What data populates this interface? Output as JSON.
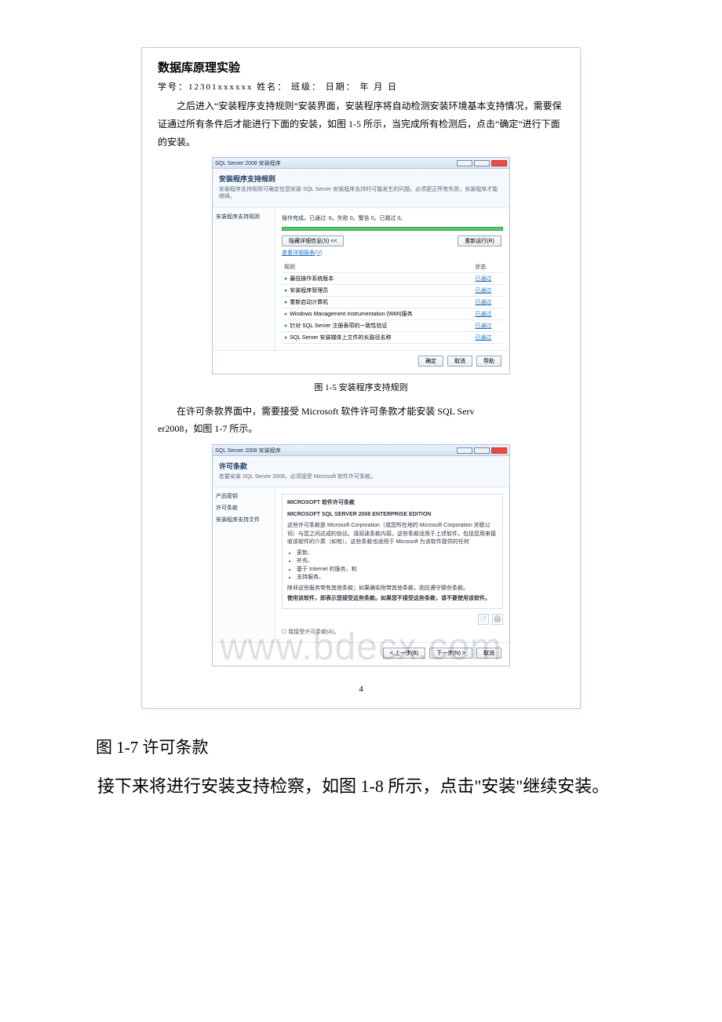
{
  "document": {
    "title": "数据库原理实验",
    "meta": "学号：12301xxxxxx    姓名：          班级：          日期：  年  月  日",
    "para1": "之后进入“安装程序支持规则”安装界面，安装程序将自动检测安装环境基本支持情况，需要保证通过所有条件后才能进行下面的安装，如图 1-5 所示，当完成所有检测后，点击“确定”进行下面的安装。",
    "para2_a": "在许可条款界面中，需要接受 Microsoft 软件许可条款才能安装 SQL Serv",
    "para2_b": "er2008，如图 1-7 所示。",
    "caption1": "图 1-5 安装程序支持规则",
    "page_num": "4"
  },
  "shot1": {
    "titlebar": "SQL Server 2008 安装程序",
    "heading": "安装程序支持规则",
    "desc": "安装程序支持规则可确定在您安装 SQL Server 安装程序支持时可能发生的问题。必须更正所有失败，安装程序才能继续。",
    "nav": [
      "安装程序支持规则"
    ],
    "status": "操作完成。已通过: 6。失败 0。警告 0。已跳过 0。",
    "btn_hide": "隐藏详细信息(S) <<",
    "btn_report": "查看详细报表(V)",
    "btn_rerun": "重新运行(R)",
    "table_head": [
      "规则",
      "状态"
    ],
    "rules": [
      {
        "name": "最低操作系统版本",
        "status": "已通过"
      },
      {
        "name": "安装程序管理员",
        "status": "已通过"
      },
      {
        "name": "重新启动计算机",
        "status": "已通过"
      },
      {
        "name": "Windows Management Instrumentation (WMI)服务",
        "status": "已通过"
      },
      {
        "name": "针对 SQL Server 注册表项的一致性验证",
        "status": "已通过"
      },
      {
        "name": "SQL Server 安装媒体上文件的长路径名称",
        "status": "已通过"
      }
    ],
    "footer": [
      "确定",
      "取消",
      "帮助"
    ]
  },
  "shot2": {
    "titlebar": "SQL Server 2008 安装程序",
    "heading": "许可条款",
    "desc": "若要安装 SQL Server 2008，必须接受 Microsoft 软件许可条款。",
    "nav": [
      "产品密钥",
      "许可条款",
      "安装程序支持文件"
    ],
    "lic_title": "MICROSOFT 软件许可条款",
    "lic_sub": "MICROSOFT SQL SERVER 2008 ENTERPRISE EDITION",
    "lic_body": "这些许可条款是 Microsoft Corporation（或您所在地的 Microsoft Corporation 关联公司）与您之间达成的协议。请阅读条款内容。这些条款适用于上述软件，包括您用来接收该软件的介质（如有）。这些条款也适用于 Microsoft 为该软件提供的任何",
    "bullets": [
      "更新、",
      "补充、",
      "基于 Internet 的服务，和",
      "支持服务。"
    ],
    "lic_tail": "除非这些服务带有其他条款；如果确实附带其他条款，则应遵守那些条款。",
    "lic_tail2": "使用该软件，即表示您接受这些条款。如果您不接受这些条款，请不要使用该软件。",
    "copy_icon": "📄",
    "print_icon": "🖨",
    "checkbox": "☐ 我接受许可条款(A)。",
    "footer": [
      "< 上一步(B)",
      "下一步(N) >",
      "取消"
    ]
  },
  "below": {
    "caption": "图 1-7 许可条款",
    "para": "接下来将进行安装支持检察，如图 1-8 所示，点击\"安装\"继续安装。"
  },
  "watermark": "www.bdecx.com"
}
